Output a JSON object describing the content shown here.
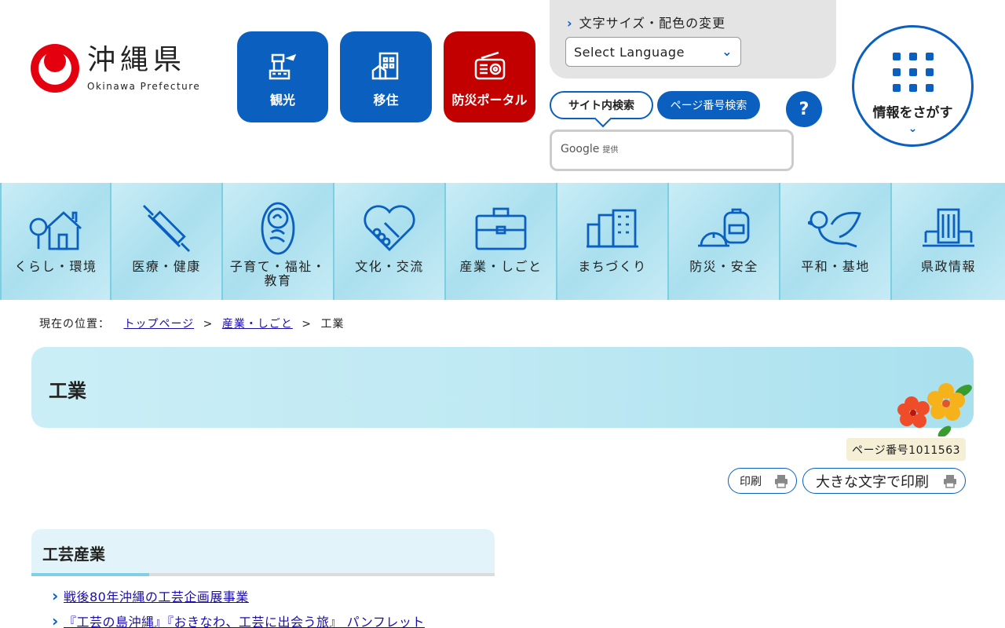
{
  "header": {
    "logo_jp": "沖縄県",
    "logo_en": "Okinawa Prefecture",
    "quick_links": [
      {
        "label": "観光",
        "icon": "observation-tower-icon"
      },
      {
        "label": "移住",
        "icon": "house-icon"
      },
      {
        "label": "防災ポータル",
        "icon": "radio-icon"
      }
    ],
    "font_color_link": "文字サイズ・配色の変更",
    "language_select": "Select Language",
    "search_tabs": [
      "サイト内検索",
      "ページ番号検索"
    ],
    "help_label": "?",
    "search_placeholder_brand": "Google",
    "search_placeholder_suffix": "提供",
    "info_search_label": "情報をさがす"
  },
  "global_nav": [
    {
      "label": "くらし・環境",
      "icon": "house-tree-icon"
    },
    {
      "label": "医療・健康",
      "icon": "syringe-icon"
    },
    {
      "label": "子育て・福祉・\n教育",
      "icon": "baby-icon"
    },
    {
      "label": "文化・交流",
      "icon": "handshake-heart-icon"
    },
    {
      "label": "産業・しごと",
      "icon": "briefcase-icon"
    },
    {
      "label": "まちづくり",
      "icon": "buildings-icon"
    },
    {
      "label": "防災・安全",
      "icon": "helmet-bag-icon"
    },
    {
      "label": "平和・基地",
      "icon": "dove-icon"
    },
    {
      "label": "県政情報",
      "icon": "government-building-icon"
    }
  ],
  "breadcrumb": {
    "prefix": "現在の位置：",
    "items": [
      "トップページ",
      "産業・しごと"
    ],
    "separator": ">",
    "current": "工業"
  },
  "page": {
    "title": "工業",
    "page_number": "ページ番号1011563",
    "print_label": "印刷",
    "print_large_label": "大きな文字で印刷"
  },
  "section": {
    "heading": "工芸産業",
    "links": [
      "戦後80年沖縄の工芸企画展事業",
      "『工芸の島沖縄』『おきなわ、工芸に出会う旅』 パンフレット"
    ]
  },
  "colors": {
    "primary_blue": "#0b5fbf",
    "disaster_red": "#c20000",
    "logo_red": "#e4000f"
  }
}
